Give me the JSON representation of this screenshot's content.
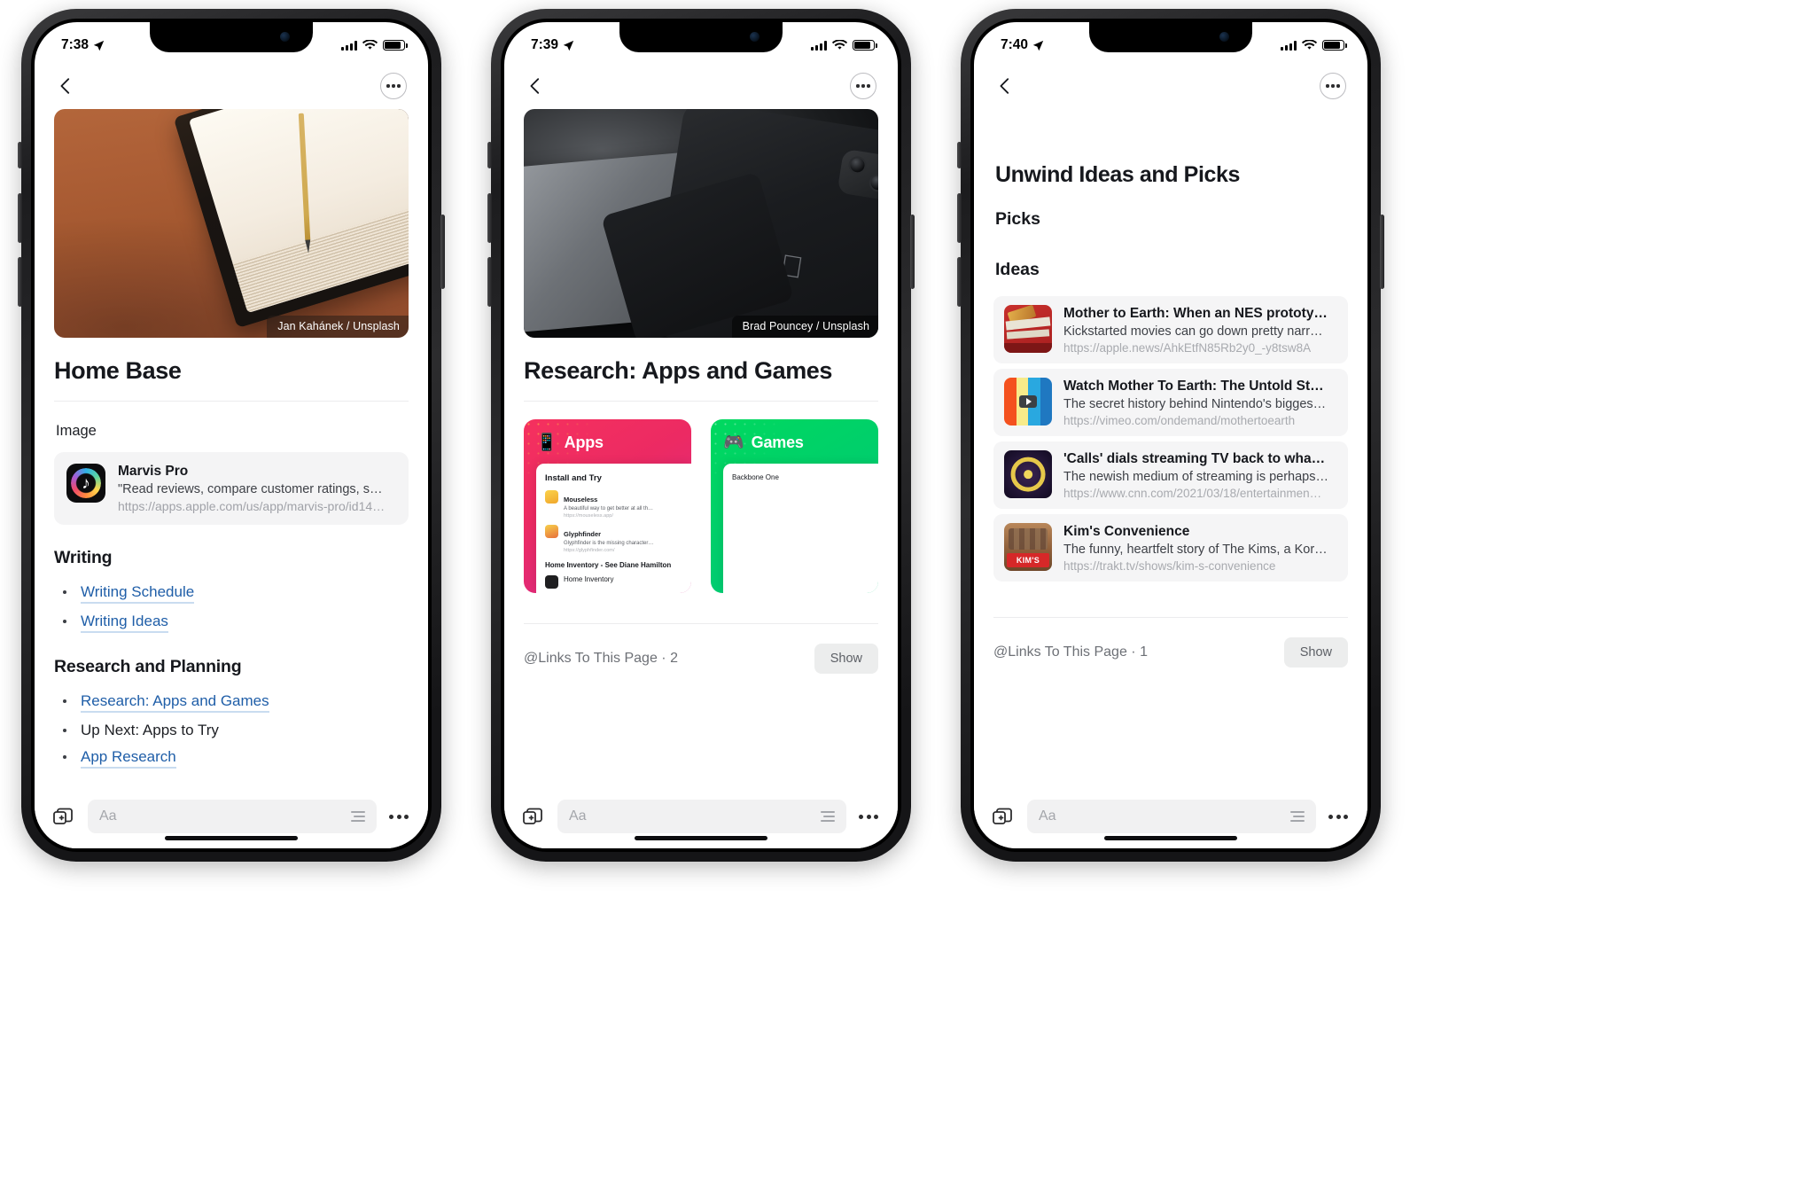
{
  "phones": [
    {
      "id": "phone-1",
      "status": {
        "time": "7:38",
        "location_icon": "location-arrow-icon",
        "signal_icon": "cellular-signal-icon",
        "wifi_icon": "wifi-icon",
        "battery_icon": "battery-icon"
      },
      "nav": {
        "back_icon": "chevron-left-icon",
        "more_icon": "ellipsis-circle-icon"
      },
      "hero": {
        "credit": "Jan Kahánek / Unsplash",
        "alt": "notebook-and-pencil-photo"
      },
      "title": "Home Base",
      "image_label": "Image",
      "link_card": {
        "icon": "marvis-pro-app-icon",
        "title": "Marvis Pro",
        "description": "\"Read reviews, compare customer ratings, s…",
        "url": "https://apps.apple.com/us/app/marvis-pro/id14…"
      },
      "sections": [
        {
          "heading": "Writing",
          "items": [
            {
              "label": "Writing Schedule",
              "link": true
            },
            {
              "label": "Writing Ideas",
              "link": true
            }
          ]
        },
        {
          "heading": "Research and Planning",
          "items": [
            {
              "label": "Research: Apps and Games",
              "link": true
            },
            {
              "label": "Up Next: Apps to Try",
              "link": false
            },
            {
              "label": "App Research",
              "link": true
            }
          ]
        }
      ],
      "toolbar": {
        "insert_icon": "insert-block-icon",
        "placeholder": "Aa",
        "format_icon": "text-format-icon",
        "more_icon": "ellipsis-icon"
      }
    },
    {
      "id": "phone-2",
      "status": {
        "time": "7:39",
        "location_icon": "location-arrow-icon",
        "signal_icon": "cellular-signal-icon",
        "wifi_icon": "wifi-icon",
        "battery_icon": "battery-icon"
      },
      "nav": {
        "back_icon": "chevron-left-icon",
        "more_icon": "ellipsis-circle-icon"
      },
      "hero": {
        "credit": "Brad Pouncey / Unsplash",
        "alt": "macbook-and-iphone-photo"
      },
      "title": "Research: Apps and Games",
      "cards": [
        {
          "emoji": "📱",
          "label": "Apps",
          "accent": "#f5315e",
          "sheet": {
            "heading": "Install and Try",
            "rows": [
              {
                "title": "Mouseless",
                "desc": "A beautiful way to get better at all th…",
                "url": "https://mouseless.app/"
              },
              {
                "title": "Glyphfinder",
                "desc": "Glyphfinder is the missing character…",
                "url": "https://glyphfinder.com/"
              }
            ],
            "section": "Home Inventory - See Diane Hamilton",
            "plain": "Home Inventory"
          }
        },
        {
          "emoji": "🎮",
          "label": "Games",
          "accent": "#00d95f",
          "sheet": {
            "heading": "",
            "rows": [],
            "section": "",
            "plain": "Backbone One"
          }
        }
      ],
      "backlinks": {
        "label": "@Links To This Page · 2",
        "show_label": "Show"
      },
      "toolbar": {
        "insert_icon": "insert-block-icon",
        "placeholder": "Aa",
        "format_icon": "text-format-icon",
        "more_icon": "ellipsis-icon"
      }
    },
    {
      "id": "phone-3",
      "status": {
        "time": "7:40",
        "location_icon": "location-arrow-icon",
        "signal_icon": "cellular-signal-icon",
        "wifi_icon": "wifi-icon",
        "battery_icon": "battery-icon"
      },
      "nav": {
        "back_icon": "chevron-left-icon",
        "more_icon": "ellipsis-circle-icon"
      },
      "title": "Unwind Ideas and Picks",
      "sections": [
        {
          "heading": "Picks"
        },
        {
          "heading": "Ideas"
        }
      ],
      "items": [
        {
          "thumb": "nes-prototype-thumbnail",
          "title": "Mother to Earth: When an NES prototy…",
          "desc": "Kickstarted movies can go down pretty narr…",
          "url": "https://apple.news/AhkEtfN85Rb2y0_-y8tsw8A"
        },
        {
          "thumb": "vimeo-video-thumbnail",
          "title": "Watch Mother To Earth: The Untold St…",
          "desc": "The secret history behind Nintendo's bigges…",
          "url": "https://vimeo.com/ondemand/mothertoearth"
        },
        {
          "thumb": "cnn-article-thumbnail",
          "title": "'Calls' dials streaming TV back to wha…",
          "desc": "The newish medium of streaming is perhaps…",
          "url": "https://www.cnn.com/2021/03/18/entertainmen…"
        },
        {
          "thumb": "kims-convenience-thumbnail",
          "title": "Kim's Convenience",
          "desc": "The funny, heartfelt story of The Kims, a Kor…",
          "url": "https://trakt.tv/shows/kim-s-convenience"
        }
      ],
      "backlinks": {
        "label": "@Links To This Page · 1",
        "show_label": "Show"
      },
      "toolbar": {
        "insert_icon": "insert-block-icon",
        "placeholder": "Aa",
        "format_icon": "text-format-icon",
        "more_icon": "ellipsis-icon"
      }
    }
  ]
}
